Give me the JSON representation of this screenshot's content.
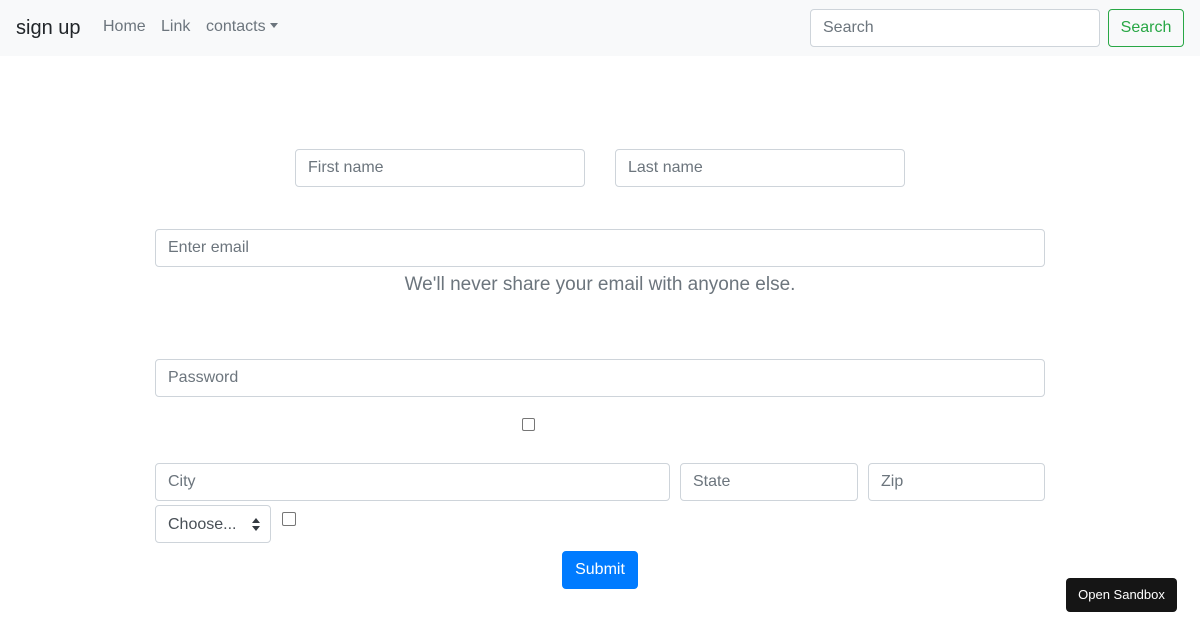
{
  "navbar": {
    "brand": "sign up",
    "links": {
      "home": "Home",
      "link": "Link",
      "contacts": "contacts"
    },
    "search": {
      "placeholder": "Search",
      "value": "",
      "button_label": "Search"
    }
  },
  "form": {
    "first_name": {
      "placeholder": "First name",
      "value": ""
    },
    "last_name": {
      "placeholder": "Last name",
      "value": ""
    },
    "email": {
      "placeholder": "Enter email",
      "value": ""
    },
    "email_help": "We'll never share your email with anyone else.",
    "password": {
      "placeholder": "Password",
      "value": ""
    },
    "checkbox_1_checked": false,
    "city": {
      "placeholder": "City",
      "value": ""
    },
    "state": {
      "placeholder": "State",
      "value": ""
    },
    "zip": {
      "placeholder": "Zip",
      "value": ""
    },
    "select": {
      "selected": "Choose..."
    },
    "checkbox_2_checked": false,
    "submit_label": "Submit"
  },
  "sandbox_button": "Open Sandbox",
  "colors": {
    "navbar_bg": "#f8f9fa",
    "search_button": "#28a745",
    "submit_button": "#007bff",
    "sandbox_button_bg": "#151515",
    "muted_text": "#6c757d"
  },
  "icons": {
    "dropdown_caret": "chevron-down-icon",
    "select_arrows": "sort-arrows-icon"
  }
}
